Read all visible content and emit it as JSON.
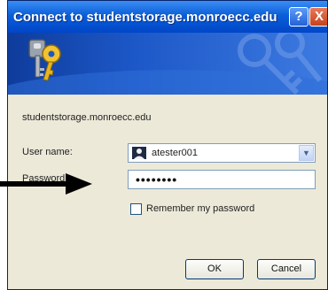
{
  "dialog": {
    "title": "Connect to studentstorage.monroecc.edu",
    "help_button": "?",
    "close_button": "X",
    "server": "studentstorage.monroecc.edu",
    "user_name_label": "User name:",
    "user_name_value": "atester001",
    "password_label": "Password:",
    "password_value": "••••••••",
    "remember_label": "Remember my password",
    "remember_checked": false,
    "ok_label": "OK",
    "cancel_label": "Cancel"
  },
  "icons": {
    "keys": "keys-icon",
    "user": "user-avatar-icon",
    "dropdown": "chevron-down-icon",
    "arrow": "arrow-right-icon"
  },
  "colors": {
    "title_bar": "#0a5fd8",
    "banner": "#1d58c8",
    "dialog_bg": "#ece9d8",
    "close_button": "#c4421a",
    "arrow": "#000000"
  }
}
